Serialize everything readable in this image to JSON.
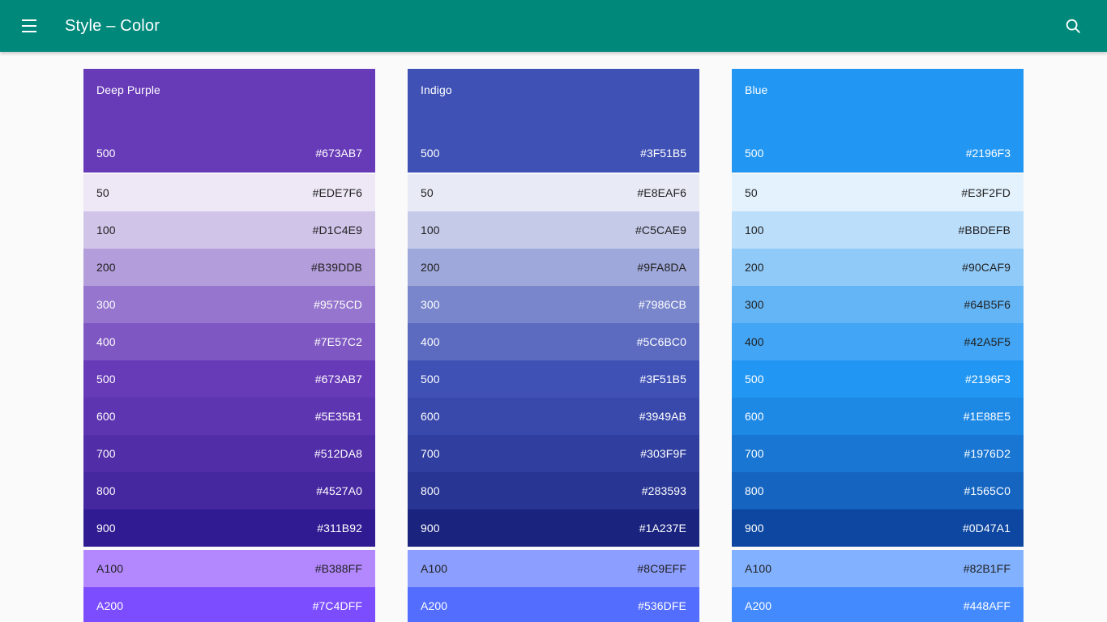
{
  "appbar": {
    "background": "#00897B",
    "title": "Style  –  Color",
    "menu_icon": "hamburger-menu-icon",
    "search_icon": "search-icon"
  },
  "page": {
    "background": "#FAFAFA"
  },
  "palettes": [
    {
      "name": "Deep Purple",
      "header": {
        "label": "500",
        "hex": "#673AB7",
        "bg": "#673AB7",
        "text": "light"
      },
      "primary_shades": [
        {
          "label": "50",
          "hex": "#EDE7F6",
          "bg": "#EDE7F6",
          "text": "dark"
        },
        {
          "label": "100",
          "hex": "#D1C4E9",
          "bg": "#D1C4E9",
          "text": "dark"
        },
        {
          "label": "200",
          "hex": "#B39DDB",
          "bg": "#B39DDB",
          "text": "dark"
        },
        {
          "label": "300",
          "hex": "#9575CD",
          "bg": "#9575CD",
          "text": "light"
        },
        {
          "label": "400",
          "hex": "#7E57C2",
          "bg": "#7E57C2",
          "text": "light"
        },
        {
          "label": "500",
          "hex": "#673AB7",
          "bg": "#673AB7",
          "text": "light"
        },
        {
          "label": "600",
          "hex": "#5E35B1",
          "bg": "#5E35B1",
          "text": "light"
        },
        {
          "label": "700",
          "hex": "#512DA8",
          "bg": "#512DA8",
          "text": "light"
        },
        {
          "label": "800",
          "hex": "#4527A0",
          "bg": "#4527A0",
          "text": "light"
        },
        {
          "label": "900",
          "hex": "#311B92",
          "bg": "#311B92",
          "text": "light"
        }
      ],
      "accent_shades": [
        {
          "label": "A100",
          "hex": "#B388FF",
          "bg": "#B388FF",
          "text": "dark"
        },
        {
          "label": "A200",
          "hex": "#7C4DFF",
          "bg": "#7C4DFF",
          "text": "light"
        }
      ]
    },
    {
      "name": "Indigo",
      "header": {
        "label": "500",
        "hex": "#3F51B5",
        "bg": "#3F51B5",
        "text": "light"
      },
      "primary_shades": [
        {
          "label": "50",
          "hex": "#E8EAF6",
          "bg": "#E8EAF6",
          "text": "dark"
        },
        {
          "label": "100",
          "hex": "#C5CAE9",
          "bg": "#C5CAE9",
          "text": "dark"
        },
        {
          "label": "200",
          "hex": "#9FA8DA",
          "bg": "#9FA8DA",
          "text": "dark"
        },
        {
          "label": "300",
          "hex": "#7986CB",
          "bg": "#7986CB",
          "text": "light"
        },
        {
          "label": "400",
          "hex": "#5C6BC0",
          "bg": "#5C6BC0",
          "text": "light"
        },
        {
          "label": "500",
          "hex": "#3F51B5",
          "bg": "#3F51B5",
          "text": "light"
        },
        {
          "label": "600",
          "hex": "#3949AB",
          "bg": "#3949AB",
          "text": "light"
        },
        {
          "label": "700",
          "hex": "#303F9F",
          "bg": "#303F9F",
          "text": "light"
        },
        {
          "label": "800",
          "hex": "#283593",
          "bg": "#283593",
          "text": "light"
        },
        {
          "label": "900",
          "hex": "#1A237E",
          "bg": "#1A237E",
          "text": "light"
        }
      ],
      "accent_shades": [
        {
          "label": "A100",
          "hex": "#8C9EFF",
          "bg": "#8C9EFF",
          "text": "dark"
        },
        {
          "label": "A200",
          "hex": "#536DFE",
          "bg": "#536DFE",
          "text": "light"
        }
      ]
    },
    {
      "name": "Blue",
      "header": {
        "label": "500",
        "hex": "#2196F3",
        "bg": "#2196F3",
        "text": "light"
      },
      "primary_shades": [
        {
          "label": "50",
          "hex": "#E3F2FD",
          "bg": "#E3F2FD",
          "text": "dark"
        },
        {
          "label": "100",
          "hex": "#BBDEFB",
          "bg": "#BBDEFB",
          "text": "dark"
        },
        {
          "label": "200",
          "hex": "#90CAF9",
          "bg": "#90CAF9",
          "text": "dark"
        },
        {
          "label": "300",
          "hex": "#64B5F6",
          "bg": "#64B5F6",
          "text": "dark"
        },
        {
          "label": "400",
          "hex": "#42A5F5",
          "bg": "#42A5F5",
          "text": "dark"
        },
        {
          "label": "500",
          "hex": "#2196F3",
          "bg": "#2196F3",
          "text": "light"
        },
        {
          "label": "600",
          "hex": "#1E88E5",
          "bg": "#1E88E5",
          "text": "light"
        },
        {
          "label": "700",
          "hex": "#1976D2",
          "bg": "#1976D2",
          "text": "light"
        },
        {
          "label": "800",
          "hex": "#1565C0",
          "bg": "#1565C0",
          "text": "light"
        },
        {
          "label": "900",
          "hex": "#0D47A1",
          "bg": "#0D47A1",
          "text": "light"
        }
      ],
      "accent_shades": [
        {
          "label": "A100",
          "hex": "#82B1FF",
          "bg": "#82B1FF",
          "text": "dark"
        },
        {
          "label": "A200",
          "hex": "#448AFF",
          "bg": "#448AFF",
          "text": "light"
        }
      ]
    }
  ]
}
